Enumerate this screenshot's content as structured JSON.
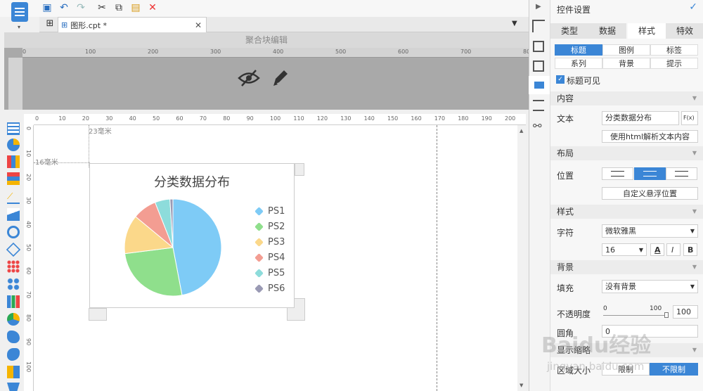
{
  "tab": {
    "label": "图形.cpt *"
  },
  "subtitle": "聚合块编辑",
  "canvas": {
    "label_w": "23毫米",
    "label_h": "16毫米"
  },
  "ruler_top": [
    "0",
    "10",
    "20",
    "30",
    "40",
    "50",
    "60",
    "70",
    "80",
    "90",
    "100",
    "110",
    "120",
    "130",
    "140",
    "150",
    "160",
    "170",
    "180",
    "190",
    "200"
  ],
  "ruler_top_big": [
    "0",
    "100",
    "200",
    "300",
    "400",
    "500",
    "600",
    "700",
    "80"
  ],
  "ruler_left": [
    "0",
    "10",
    "20",
    "30",
    "40",
    "50",
    "60",
    "70",
    "80",
    "90",
    "100"
  ],
  "chart_data": {
    "type": "pie",
    "title": "分类数据分布",
    "categories": [
      "PS1",
      "PS2",
      "PS3",
      "PS4",
      "PS5",
      "PS6"
    ],
    "values": [
      47,
      26,
      13,
      8,
      5,
      1
    ],
    "colors": [
      "#7ecbf6",
      "#8fdf8c",
      "#fbd88a",
      "#f39d92",
      "#8ddcdb",
      "#9a9ab4"
    ],
    "legend": "right"
  },
  "panel": {
    "header": "控件设置",
    "tabs": [
      "类型",
      "数据",
      "样式",
      "特效"
    ],
    "subtabs": [
      "标题",
      "图例",
      "标签",
      "系列",
      "背景",
      "提示"
    ],
    "title_visible": "标题可见",
    "section_content": "内容",
    "text_label": "文本",
    "text_value": "分类数据分布",
    "fx": "F(x)",
    "html_button": "使用html解析文本内容",
    "section_layout": "布局",
    "position_label": "位置",
    "custom_float": "自定义悬浮位置",
    "section_style": "样式",
    "font_label": "字符",
    "font_value": "微软雅黑",
    "font_size": "16",
    "bold": "B",
    "italic": "I",
    "fontcolor": "A",
    "section_bg": "背景",
    "fill_label": "填充",
    "fill_value": "没有背景",
    "opacity_label": "不透明度",
    "opacity_min": "0",
    "opacity_max": "100",
    "opacity_value": "100",
    "radius_label": "圆角",
    "radius_value": "0",
    "section_zoom": "显示缩略",
    "zoom_label": "区域大小",
    "limit": "限制",
    "nolimit": "不限制"
  },
  "watermark": {
    "line1": "Baidu经验",
    "line2": "jingyan.baidu.com"
  }
}
